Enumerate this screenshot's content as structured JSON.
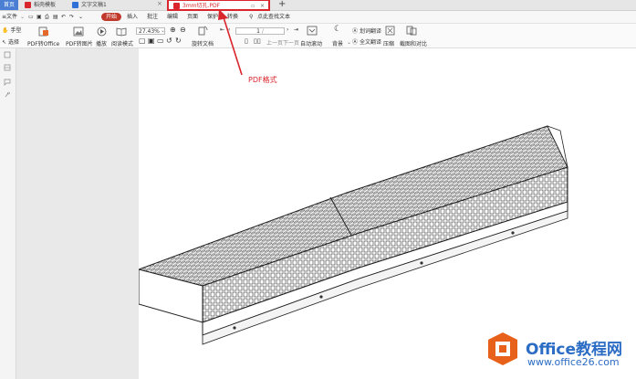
{
  "tabs": [
    {
      "label": "首页"
    },
    {
      "label": "稻壳模板"
    },
    {
      "label": "文字文稿1"
    },
    {
      "label": "3mm切孔.PDF"
    }
  ],
  "menu": {
    "file": "文件",
    "items": [
      "开始",
      "插入",
      "批注",
      "编辑",
      "页面",
      "保护",
      "转换"
    ],
    "search": "点此查找文本"
  },
  "toolbar": {
    "hand": "手型",
    "select": "选择",
    "pdf_to_office": "PDF转Office",
    "pdf_to_image": "PDF转图片",
    "play": "播放",
    "read_mode": "阅读模式",
    "zoom": "27.43%",
    "rotate": "旋转文档",
    "page_value": "1",
    "prev": "上一页",
    "next": "下一页",
    "auto_scroll": "自动滚动",
    "background": "背景",
    "translate_word": "划词翻译",
    "translate_all": "全文翻译",
    "compress": "压缩",
    "screenshot": "截图和对比"
  },
  "annotation": {
    "label": "PDF格式",
    "color": "#d9262c"
  },
  "watermark": {
    "title": "Office教程网",
    "url": "www.office26.com"
  },
  "colors": {
    "accent": "#d9262c",
    "home_tab": "#4a7fd4",
    "brand": "#2b6cc4",
    "logo": "#e8611a"
  }
}
